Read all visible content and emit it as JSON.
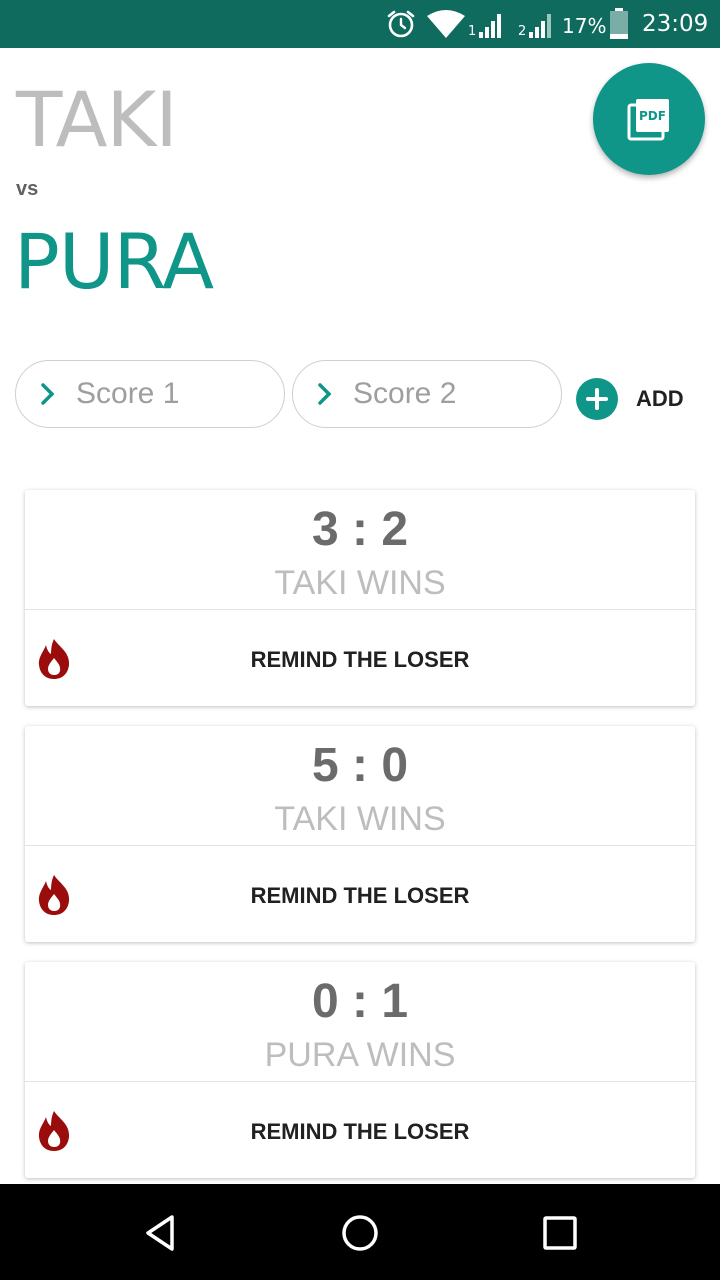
{
  "status_bar": {
    "sim1": "1",
    "sim2": "2",
    "battery": "17%",
    "time": "23:09",
    "icons": [
      "alarm-icon",
      "wifi-icon",
      "signal-sim1-icon",
      "signal-sim2-icon",
      "battery-icon"
    ]
  },
  "header": {
    "team1": "TAKI",
    "vs": "vs",
    "team2": "PURA",
    "pdf_button_label": "PDF"
  },
  "form": {
    "score1_placeholder": "Score 1",
    "score2_placeholder": "Score 2",
    "add_label": "ADD"
  },
  "matches": [
    {
      "score": "3 : 2",
      "result": "TAKI WINS",
      "action": "REMIND THE LOSER"
    },
    {
      "score": "5 : 0",
      "result": "TAKI WINS",
      "action": "REMIND THE LOSER"
    },
    {
      "score": "0 : 1",
      "result": "PURA WINS",
      "action": "REMIND THE LOSER"
    }
  ],
  "colors": {
    "accent": "#0f9688",
    "status_bar": "#0e6b5e",
    "fire_icon": "#9b0d0d",
    "team1_text": "#bdbdbd"
  },
  "nav": [
    "back-icon",
    "home-icon",
    "recents-icon"
  ]
}
